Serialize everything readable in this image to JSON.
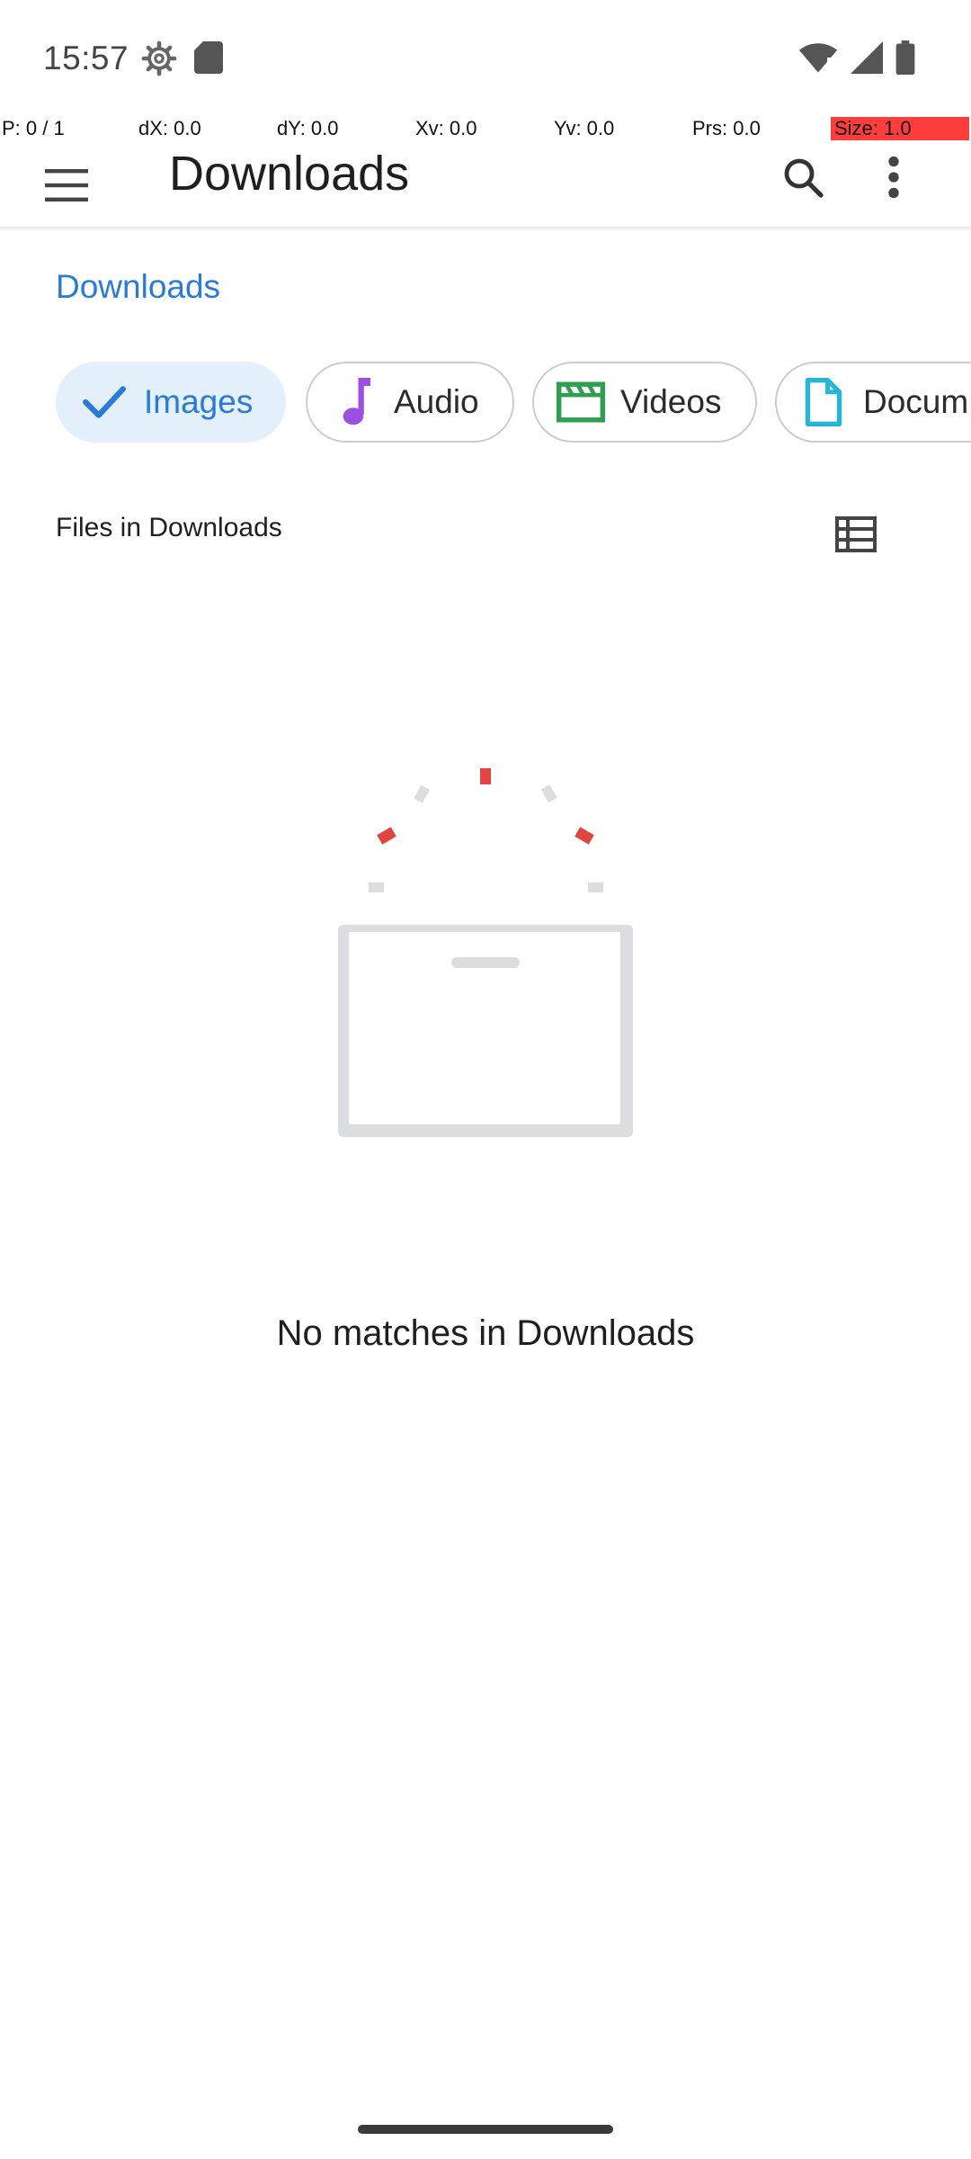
{
  "status_bar": {
    "time": "15:57",
    "icons": [
      "settings-gear-icon",
      "sd-card-icon",
      "wifi-icon",
      "cellular-signal-icon",
      "battery-icon"
    ]
  },
  "debug_overlay": {
    "pointer": "P: 0 / 1",
    "dx": "dX: 0.0",
    "dy": "dY: 0.0",
    "xv": "Xv: 0.0",
    "yv": "Yv: 0.0",
    "prs": "Prs: 0.0",
    "size": "Size: 1.0",
    "size_color": "#ff3d3d"
  },
  "app_bar": {
    "title": "Downloads",
    "icons": [
      "menu-icon",
      "search-icon",
      "more-vert-icon"
    ]
  },
  "breadcrumb": {
    "root": "Downloads"
  },
  "chips": [
    {
      "label": "Images",
      "icon": "check-icon",
      "selected": true
    },
    {
      "label": "Audio",
      "icon": "music-note-icon",
      "selected": false
    },
    {
      "label": "Videos",
      "icon": "clapperboard-icon",
      "selected": false
    },
    {
      "label": "Docum",
      "icon": "document-icon",
      "selected": false
    }
  ],
  "list": {
    "section_title": "Files in Downloads",
    "view_toggle_icon": "list-view-icon"
  },
  "empty_state": {
    "message": "No matches in Downloads"
  },
  "colors": {
    "accent": "#2a7bd8",
    "selected_chip_bg": "#e3f0fc",
    "audio_icon": "#9c4fe0",
    "video_icon": "#2e9e4f",
    "document_icon": "#28b6d6",
    "illustration_red": "#e0463f",
    "illustration_gray": "#dcdde0"
  }
}
